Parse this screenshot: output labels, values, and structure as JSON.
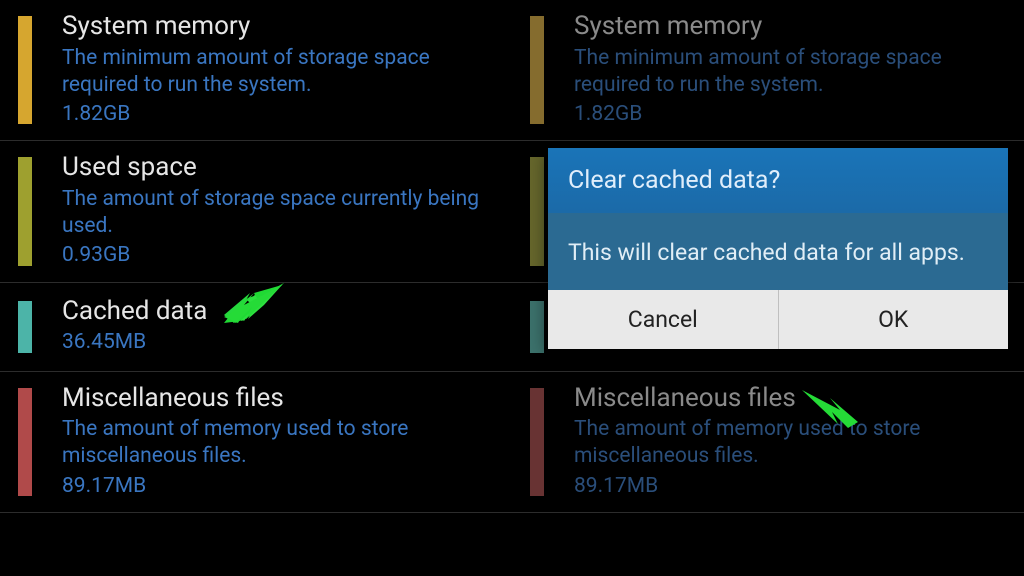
{
  "storage": {
    "items": [
      {
        "title": "System memory",
        "desc": "The minimum amount of storage space required to run the system.",
        "size": "1.82GB",
        "color": "sys"
      },
      {
        "title": "Used space",
        "desc": "The amount of storage space currently being used.",
        "size": "0.93GB",
        "color": "used"
      },
      {
        "title": "Cached data",
        "desc": "",
        "size": "36.45MB",
        "color": "cache"
      },
      {
        "title": "Miscellaneous files",
        "desc": "The amount of memory used to store miscellaneous files.",
        "size": "89.17MB",
        "color": "misc"
      }
    ]
  },
  "dialog": {
    "title": "Clear cached data?",
    "message": "This will clear cached data for all apps.",
    "cancel": "Cancel",
    "ok": "OK"
  }
}
